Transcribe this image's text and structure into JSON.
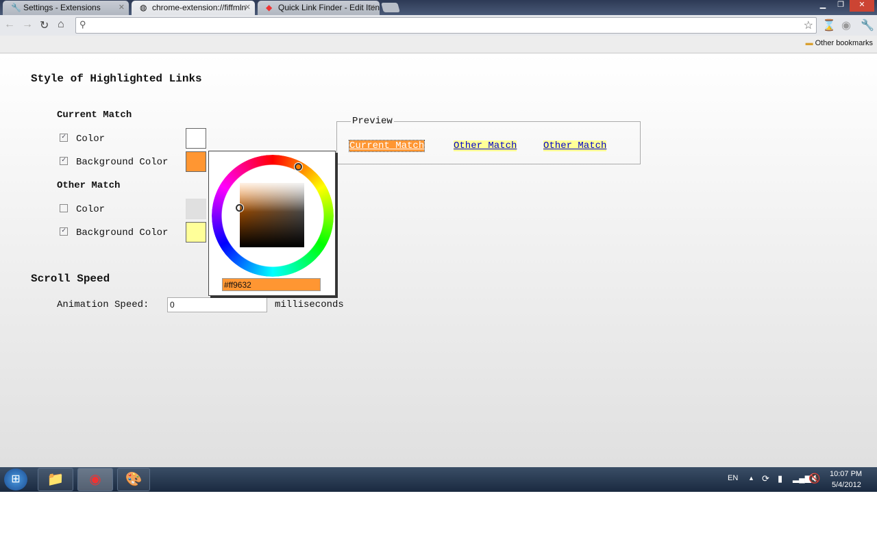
{
  "browser": {
    "tabs": [
      {
        "label": "Settings - Extensions",
        "icon": "wrench-icon"
      },
      {
        "label": "chrome-extension://fiffmln",
        "icon": "globe-icon"
      },
      {
        "label": "Quick Link Finder - Edit Iten",
        "icon": "quick-link-icon"
      }
    ],
    "omnibox": "",
    "other_bookmarks": "Other bookmarks"
  },
  "page": {
    "style_heading": "Style of Highlighted Links",
    "current_match": {
      "heading": "Current Match",
      "color_label": "Color",
      "color_checked": true,
      "color_value": "#ffffff",
      "bg_label": "Background Color",
      "bg_checked": true,
      "bg_value": "#ff9632"
    },
    "other_match": {
      "heading": "Other Match",
      "color_label": "Color",
      "color_checked": false,
      "color_value": "#e0e0e0",
      "bg_label": "Background Color",
      "bg_checked": true,
      "bg_value": "#ffff99"
    },
    "picker": {
      "hex": "#ff9632"
    },
    "preview": {
      "legend": "Preview",
      "links": [
        "Current Match",
        "Other Match",
        "Other Match"
      ]
    },
    "scroll_heading": "Scroll Speed",
    "animation_label": "Animation Speed:",
    "animation_value": "0",
    "animation_unit": "milliseconds"
  },
  "taskbar": {
    "language": "EN",
    "time": "10:07 PM",
    "date": "5/4/2012"
  }
}
